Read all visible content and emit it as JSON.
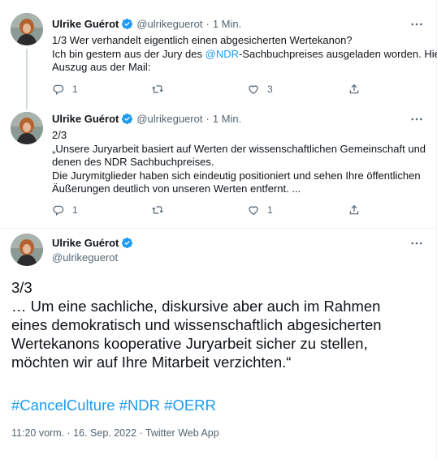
{
  "colors": {
    "accent": "#1d9bf0",
    "text": "#0f1419",
    "muted": "#536471",
    "verified": "#1d9bf0"
  },
  "tweets": [
    {
      "name": "Ulrike Guérot",
      "handle": "@ulrikeguerot",
      "time": "1 Min.",
      "lines": [
        "1/3 Wer verhandelt eigentlich einen abgesicherten Wertekanon?",
        "Ich bin gestern aus der Jury des",
        "Auszug aus der Mail:"
      ],
      "mention": "@NDR",
      "mention_after": "-Sachbuchpreises ausgeladen worden. Hier",
      "counts": {
        "reply": "1",
        "retweet": "",
        "like": "3"
      }
    },
    {
      "name": "Ulrike Guérot",
      "handle": "@ulrikeguerot",
      "time": "1 Min.",
      "lines": [
        "2/3",
        "„Unsere Juryarbeit basiert auf Werten der wissenschaftlichen Gemeinschaft und",
        "denen des NDR Sachbuchpreises.",
        "Die Jurymitglieder haben sich eindeutig positioniert und sehen Ihre öffentlichen",
        "Äußerungen deutlich von unseren Werten entfernt. ..."
      ],
      "counts": {
        "reply": "1",
        "retweet": "",
        "like": "1"
      }
    }
  ],
  "main_tweet": {
    "name": "Ulrike Guérot",
    "handle": "@ulrikeguerot",
    "lines": [
      "3/3",
      "… Um eine sachliche, diskursive aber auch im Rahmen",
      "eines demokratisch und wissenschaftlich abgesicherten",
      "Wertekanons kooperative Juryarbeit sicher zu stellen,",
      "möchten wir auf Ihre Mitarbeit verzichten.“"
    ],
    "hashtags": "#CancelCulture #NDR #OERR",
    "meta": "11:20 vorm. · 16. Sep. 2022 · Twitter Web App"
  },
  "icons": {
    "verified": "verified-badge-icon",
    "more": "more-icon",
    "reply": "reply-icon",
    "retweet": "retweet-icon",
    "like": "like-icon",
    "share": "share-icon"
  }
}
